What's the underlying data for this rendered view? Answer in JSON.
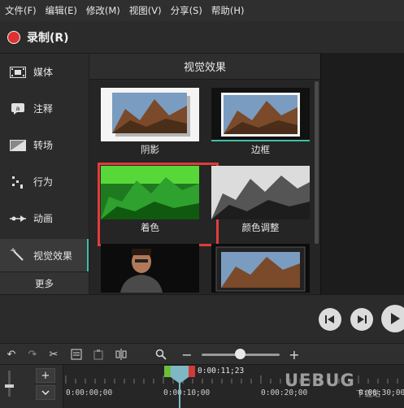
{
  "menu": {
    "items": [
      "文件(F)",
      "编辑(E)",
      "修改(M)",
      "视图(V)",
      "分享(S)",
      "帮助(H)"
    ]
  },
  "record": {
    "label": "录制(R)"
  },
  "sidebar": {
    "items": [
      {
        "label": "媒体",
        "icon": "film-icon"
      },
      {
        "label": "注释",
        "icon": "annotation-icon"
      },
      {
        "label": "转场",
        "icon": "transition-icon"
      },
      {
        "label": "行为",
        "icon": "behavior-icon"
      },
      {
        "label": "动画",
        "icon": "animation-icon"
      },
      {
        "label": "视觉效果",
        "icon": "magic-wand-icon",
        "active": true
      }
    ],
    "more_label": "更多"
  },
  "panel": {
    "title": "视觉效果",
    "tiles": [
      {
        "label": "阴影"
      },
      {
        "label": "边框"
      },
      {
        "label": "着色",
        "highlighted": true
      },
      {
        "label": "颜色调整"
      }
    ]
  },
  "timeline": {
    "playhead_time": "0:00:11;23",
    "ticks": [
      "0:00:00;00",
      "0:00:10;00",
      "0:00:20;00",
      "0:00:30;00"
    ]
  },
  "watermark": {
    "main": "UEBUG",
    "sub": "下载站"
  },
  "colors": {
    "accent": "#3fbfa6",
    "record": "#e03131",
    "highlight": "#e23b3b"
  }
}
